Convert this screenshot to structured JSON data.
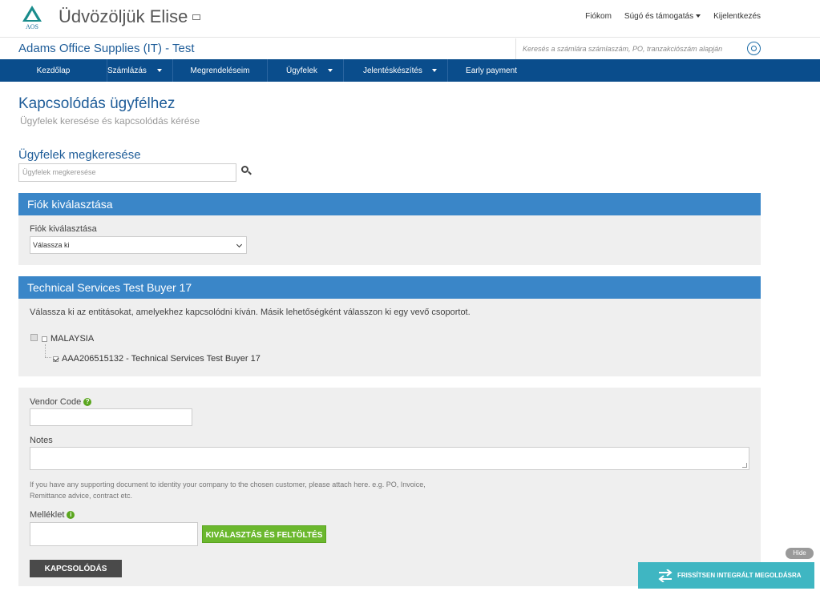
{
  "header": {
    "logo_text": "AOS",
    "welcome": "Üdvözöljük Elise",
    "links": [
      "Fiókom",
      "Súgó és támogatás",
      "Kijelentkezés"
    ]
  },
  "subheader": {
    "company": "Adams Office Supplies (IT) - Test",
    "search_placeholder": "Keresés a számlára számlaszám, PO, tranzakciószám alapján"
  },
  "nav": [
    {
      "label": "Kezdőlap",
      "dropdown": false
    },
    {
      "label": "Számlázás",
      "dropdown": true
    },
    {
      "label": "Megrendeléseim",
      "dropdown": false
    },
    {
      "label": "Ügyfelek",
      "dropdown": true
    },
    {
      "label": "Jelentéskészítés",
      "dropdown": true
    },
    {
      "label": "Early payment",
      "dropdown": false
    }
  ],
  "page": {
    "title": "Kapcsolódás ügyfélhez",
    "subtitle": "Ügyfelek keresése és kapcsolódás kérése",
    "search_title": "Ügyfelek megkeresése",
    "search_placeholder": "Ügyfelek megkeresése"
  },
  "account_panel": {
    "header": "Fiók kiválasztása",
    "label": "Fiók kiválasztása",
    "select_value": "Válassza ki"
  },
  "buyer_panel": {
    "header": "Technical Services Test Buyer 17",
    "instruction": "Válassza ki az entitásokat, amelyekhez kapcsolódni kíván. Másik lehetőségként válasszon ki egy vevő csoportot.",
    "tree": {
      "root": "MALAYSIA",
      "child": "AAA206515132 - Technical Services Test Buyer 17"
    }
  },
  "form_panel": {
    "vendor_code_label": "Vendor Code",
    "notes_label": "Notes",
    "hint": "If you have any supporting document to identity your company to the chosen customer, please attach here. e.g. PO, Invoice, Remittance advice, contract etc.",
    "attachment_label": "Melléklet",
    "upload_button": "KIVÁLASZTÁS ÉS FELTÖLTÉS",
    "submit_button": "KAPCSOLÓDÁS"
  },
  "widget": {
    "hide": "Hide",
    "refresh": "FRISSÍTSEN INTEGRÁLT MEGOLDÁSRA"
  },
  "colors": {
    "nav_bg": "#0a4d8c",
    "panel_header": "#3a86c8",
    "brand_text": "#1f5d99",
    "green_button": "#6bb82e",
    "teal_widget": "#3fb6c2"
  }
}
